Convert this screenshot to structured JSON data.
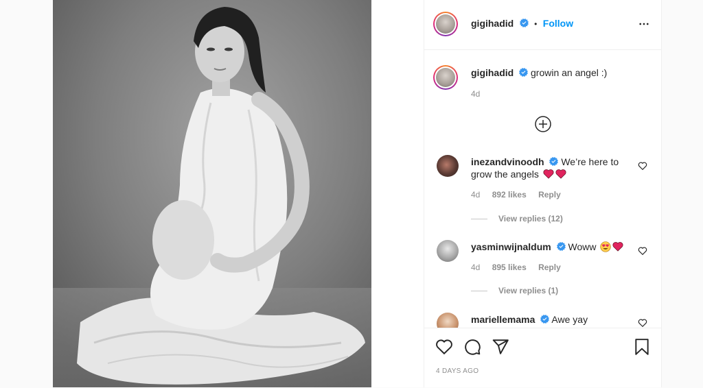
{
  "post": {
    "author": "gigihadid",
    "follow_label": "Follow",
    "separator": "•",
    "caption": "growin an angel :)",
    "caption_age": "4d",
    "timestamp": "4 DAYS AGO"
  },
  "comments": [
    {
      "username": "inezandvinoodh",
      "text": "We’re here to grow the angels",
      "emojis": [
        "red-heart",
        "red-heart"
      ],
      "age": "4d",
      "likes": "892 likes",
      "reply_label": "Reply",
      "view_replies": "View replies (12)"
    },
    {
      "username": "yasminwijnaldum",
      "text": "Woww",
      "emojis": [
        "heart-eyes-face",
        "red-heart"
      ],
      "age": "4d",
      "likes": "895 likes",
      "reply_label": "Reply",
      "view_replies": "View replies (1)"
    },
    {
      "username": "mariellemama",
      "text": "Awe yay",
      "emojis": []
    }
  ],
  "colors": {
    "accent": "#0095f6",
    "verified": "#3897f0",
    "emoji_heart": "#e0245e"
  },
  "icons": [
    "more-options-icon",
    "verified-badge-icon",
    "load-more-comments-icon",
    "like-icon",
    "comment-icon",
    "share-icon",
    "save-icon"
  ]
}
